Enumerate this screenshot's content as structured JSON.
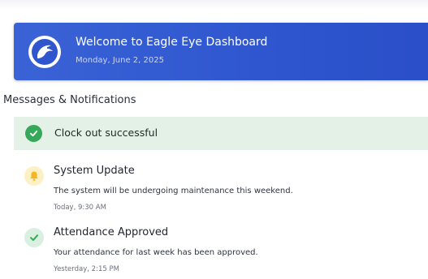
{
  "banner": {
    "title": "Welcome to Eagle Eye Dashboard",
    "date": "Monday, June 2, 2025",
    "logo_icon": "eagle-icon"
  },
  "section": {
    "title": "Messages & Notifications"
  },
  "alert": {
    "text": "Clock out successful",
    "icon": "check-circle-icon",
    "color": "#35a85a"
  },
  "notifications": [
    {
      "icon": "bell-icon",
      "title": "System Update",
      "body": "The system will be undergoing maintenance this weekend.",
      "time": "Today, 9:30 AM",
      "color": "#f2b824"
    },
    {
      "icon": "check-icon",
      "title": "Attendance Approved",
      "body": "Your attendance for last week has been approved.",
      "time": "Yesterday, 2:15 PM",
      "color": "#35a85a"
    }
  ],
  "colors": {
    "banner": "#2f56cf",
    "alert_background": "#e3f1e7"
  }
}
